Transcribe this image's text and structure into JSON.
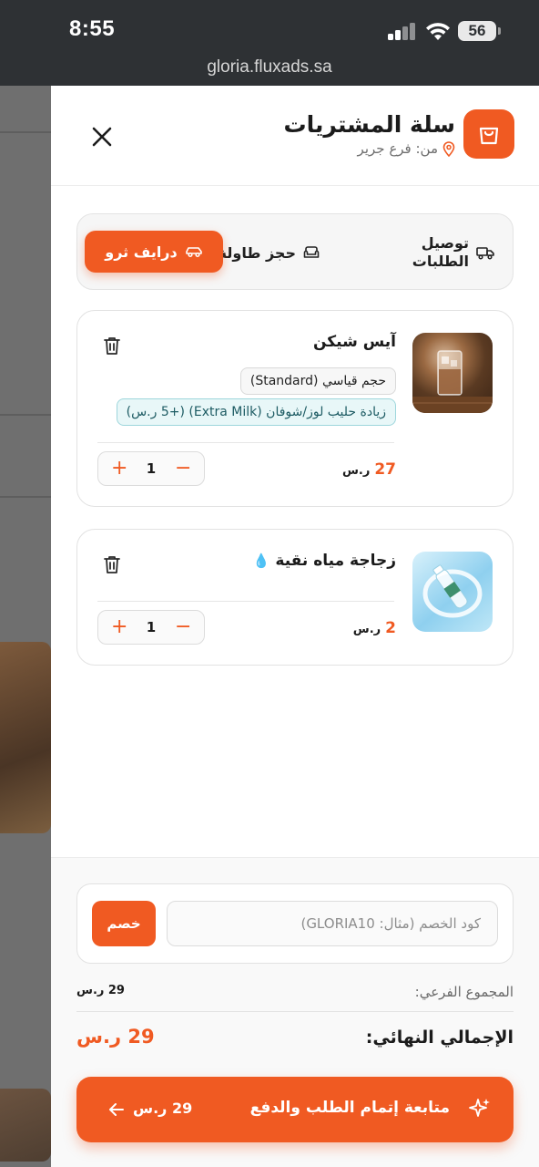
{
  "status_bar": {
    "time": "8:55",
    "battery": "56"
  },
  "browser": {
    "url": "gloria.fluxads.sa"
  },
  "cart": {
    "title": "سلة المشتريات",
    "branch": "من: فرع جرير"
  },
  "order_modes": [
    {
      "label": "توصيل الطلبات",
      "icon": "truck-icon",
      "active": false
    },
    {
      "label": "حجز طاولة",
      "icon": "armchair-icon",
      "active": false
    },
    {
      "label": "درايف ثرو",
      "icon": "car-icon",
      "active": true
    }
  ],
  "items": [
    {
      "name": "آيس شيكن",
      "options": [
        {
          "text": "حجم قياسي (Standard)",
          "style": "gray"
        },
        {
          "text": "زيادة حليب لوز/شوفان (Extra Milk) (+5 ر.س)",
          "style": "teal"
        }
      ],
      "quantity": "1",
      "price": "27",
      "currency": "ر.س"
    },
    {
      "name": "زجاجة مياه نقية",
      "emoji": "💧",
      "options": [],
      "quantity": "1",
      "price": "2",
      "currency": "ر.س"
    }
  ],
  "promo": {
    "placeholder": "كود الخصم (مثال: GLORIA10)",
    "button": "خصم"
  },
  "summary": {
    "subtotal_label": "المجموع الفرعي:",
    "subtotal_value": "29 ر.س",
    "total_label": "الإجمالي النهائي:",
    "total_value": "29 ر.س"
  },
  "checkout": {
    "label": "متابعة إتمام الطلب والدفع",
    "amount": "29 ر.س"
  },
  "colors": {
    "accent": "#f05a22",
    "teal_chip": "#e8f7f8"
  }
}
